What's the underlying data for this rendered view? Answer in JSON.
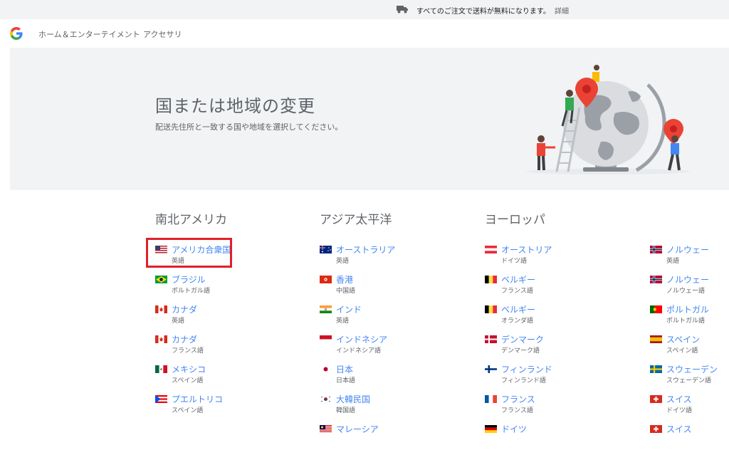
{
  "promo": {
    "text": "すべてのご注文で送料が無料になります。",
    "link": "詳細"
  },
  "nav": {
    "items": [
      "ホーム＆エンターテイメント",
      "アクセサリ"
    ]
  },
  "hero": {
    "title": "国または地域の変更",
    "subtitle": "配送先住所と一致する国や地域を選択してください。"
  },
  "regions": [
    {
      "title": "南北アメリカ",
      "countries": [
        {
          "name": "アメリカ合衆国",
          "lang": "英語",
          "flag": "us-flag-icon"
        },
        {
          "name": "ブラジル",
          "lang": "ポルトガル語",
          "flag": "brazil-flag-icon"
        },
        {
          "name": "カナダ",
          "lang": "英語",
          "flag": "canada-flag-icon"
        },
        {
          "name": "カナダ",
          "lang": "フランス語",
          "flag": "canada-flag-icon"
        },
        {
          "name": "メキシコ",
          "lang": "スペイン語",
          "flag": "mexico-flag-icon"
        },
        {
          "name": "プエルトリコ",
          "lang": "スペイン語",
          "flag": "puerto-rico-flag-icon"
        }
      ]
    },
    {
      "title": "アジア太平洋",
      "countries": [
        {
          "name": "オーストラリア",
          "lang": "英語",
          "flag": "australia-flag-icon"
        },
        {
          "name": "香港",
          "lang": "中国語",
          "flag": "hong-kong-flag-icon"
        },
        {
          "name": "インド",
          "lang": "英語",
          "flag": "india-flag-icon"
        },
        {
          "name": "インドネシア",
          "lang": "インドネシア語",
          "flag": "indonesia-flag-icon"
        },
        {
          "name": "日本",
          "lang": "日本語",
          "flag": "japan-flag-icon"
        },
        {
          "name": "大韓民国",
          "lang": "韓国語",
          "flag": "korea-flag-icon"
        },
        {
          "name": "マレーシア",
          "lang": "",
          "flag": "malaysia-flag-icon"
        }
      ]
    },
    {
      "title": "ヨーロッパ",
      "countries": [
        {
          "name": "オーストリア",
          "lang": "ドイツ語",
          "flag": "austria-flag-icon"
        },
        {
          "name": "ベルギー",
          "lang": "フランス語",
          "flag": "belgium-flag-icon"
        },
        {
          "name": "ベルギー",
          "lang": "オランダ語",
          "flag": "belgium-flag-icon"
        },
        {
          "name": "デンマーク",
          "lang": "デンマーク語",
          "flag": "denmark-flag-icon"
        },
        {
          "name": "フィンランド",
          "lang": "フィンランド語",
          "flag": "finland-flag-icon"
        },
        {
          "name": "フランス",
          "lang": "フランス語",
          "flag": "france-flag-icon"
        },
        {
          "name": "ドイツ",
          "lang": "",
          "flag": "germany-flag-icon"
        }
      ]
    },
    {
      "title": "",
      "countries": [
        {
          "name": "ノルウェー",
          "lang": "英語",
          "flag": "norway-flag-icon"
        },
        {
          "name": "ノルウェー",
          "lang": "ノルウェー語",
          "flag": "norway-flag-icon"
        },
        {
          "name": "ポルトガル",
          "lang": "ポルトガル語",
          "flag": "portugal-flag-icon"
        },
        {
          "name": "スペイン",
          "lang": "スペイン語",
          "flag": "spain-flag-icon"
        },
        {
          "name": "スウェーデン",
          "lang": "スウェーデン語",
          "flag": "sweden-flag-icon"
        },
        {
          "name": "スイス",
          "lang": "ドイツ語",
          "flag": "switzerland-flag-icon"
        },
        {
          "name": "スイス",
          "lang": "",
          "flag": "switzerland-flag-icon"
        }
      ]
    }
  ],
  "colors": {
    "link": "#4285f4",
    "highlight": "#e0212a",
    "hero_bg": "#f1f3f4"
  }
}
